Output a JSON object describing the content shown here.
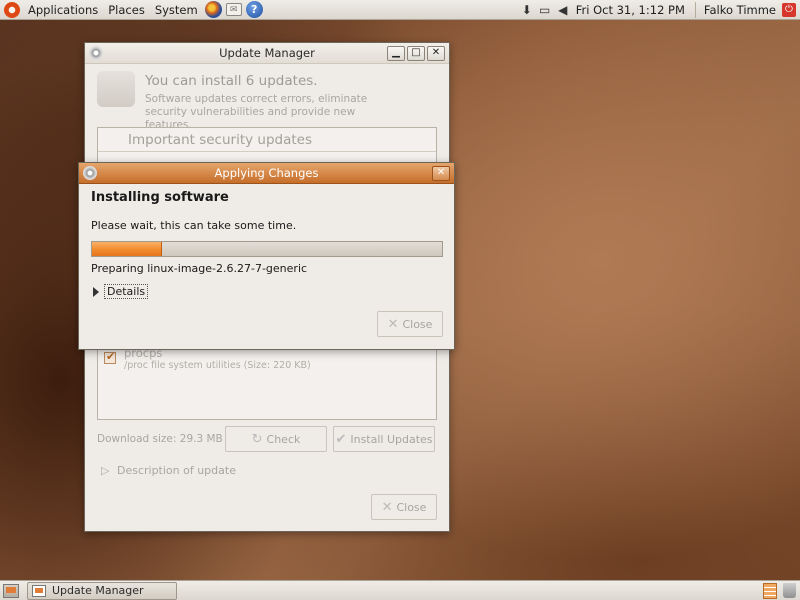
{
  "top_panel": {
    "menus": [
      "Applications",
      "Places",
      "System"
    ],
    "launchers": [
      "firefox-icon",
      "mail-icon",
      "help-icon"
    ],
    "tray_icons": [
      "download-icon",
      "network-icon",
      "volume-icon"
    ],
    "clock": "Fri Oct 31,  1:12 PM",
    "user": "Falko Timme"
  },
  "update_manager": {
    "title": "Update Manager",
    "heading": "You can install 6 updates.",
    "subtext": "Software updates correct errors, eliminate security vulnerabilities and provide new features.",
    "list_header": "Important security updates",
    "package": {
      "name": "procps",
      "description": "/proc file system utilities (Size: 220 KB)",
      "checked": true
    },
    "download_size": "Download size: 29.3 MB",
    "check_label": "Check",
    "install_label": "Install Updates",
    "description_label": "Description of update",
    "close_label": "Close"
  },
  "applying_changes": {
    "title": "Applying Changes",
    "heading": "Installing software",
    "text": "Please wait, this can take some time.",
    "progress_fraction": 0.2,
    "status": "Preparing linux-image-2.6.27-7-generic",
    "details_label": "Details",
    "close_label": "Close"
  },
  "bottom_panel": {
    "task": "Update Manager"
  },
  "colors": {
    "accent_orange": "#f08b2c",
    "titlebar_active": "#c66e2a"
  }
}
